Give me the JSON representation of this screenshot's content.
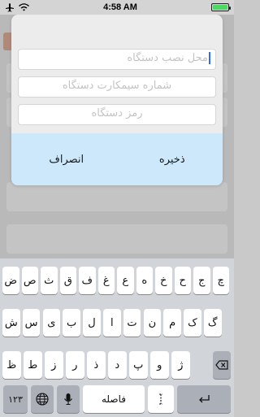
{
  "status_bar": {
    "time": "4:58 AM",
    "battery_level": 1.0
  },
  "dialog": {
    "fields": [
      {
        "placeholder": "محل نصب دستگاه",
        "focused": true
      },
      {
        "placeholder": "شماره سیمکارت دستگاه"
      },
      {
        "placeholder": "رمز دستگاه"
      }
    ],
    "save_label": "ذخیره",
    "cancel_label": "انصراف"
  },
  "keyboard": {
    "row1": [
      "ض",
      "ص",
      "ث",
      "ق",
      "ف",
      "غ",
      "ع",
      "ه",
      "خ",
      "ح",
      "ج",
      "چ"
    ],
    "row2": [
      "ش",
      "س",
      "ی",
      "ب",
      "ل",
      "ا",
      "ت",
      "ن",
      "م",
      "ک",
      "گ"
    ],
    "row3": [
      "ظ",
      "ط",
      "ز",
      "ر",
      "ذ",
      "د",
      "پ",
      "و",
      "ژ"
    ],
    "numbers_label": "۱۲۳",
    "space_label": "فاصله",
    "zwnj_label": "‌"
  }
}
